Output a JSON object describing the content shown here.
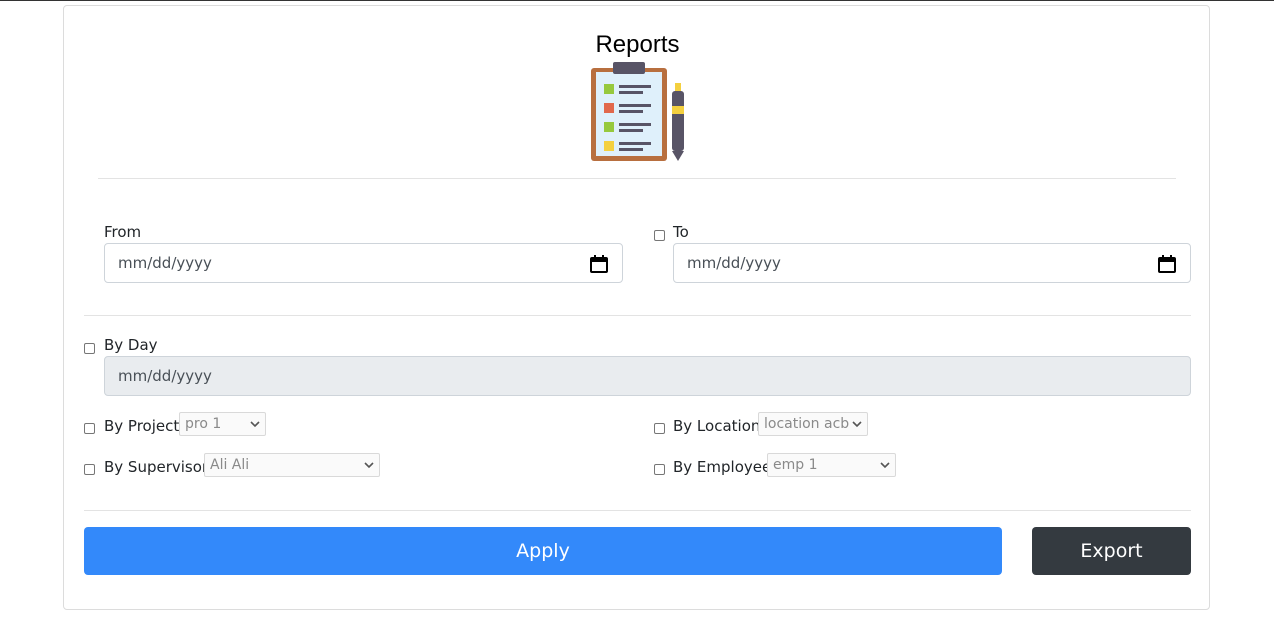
{
  "page": {
    "title": "Reports"
  },
  "filters": {
    "from": {
      "label": "From",
      "placeholder": "mm/dd/yyyy"
    },
    "to": {
      "label": "To",
      "placeholder": "mm/dd/yyyy"
    },
    "by_day": {
      "label": "By Day",
      "placeholder": "mm/dd/yyyy"
    },
    "by_project": {
      "label": "By Project",
      "selected": "pro 1"
    },
    "by_location": {
      "label": "By Location",
      "selected": "location acb"
    },
    "by_supervisor": {
      "label": "By Supervisor",
      "selected": "Ali Ali"
    },
    "by_employee": {
      "label": "By Employee",
      "selected": "emp 1"
    }
  },
  "actions": {
    "apply_label": "Apply",
    "export_label": "Export"
  },
  "colors": {
    "primary": "#3389fa",
    "dark": "#343a40",
    "border": "#ced4da",
    "disabled_bg": "#e9ecef"
  },
  "icons": {
    "header": "clipboard-icon",
    "date": "calendar-icon",
    "select": "chevron-down-icon"
  }
}
